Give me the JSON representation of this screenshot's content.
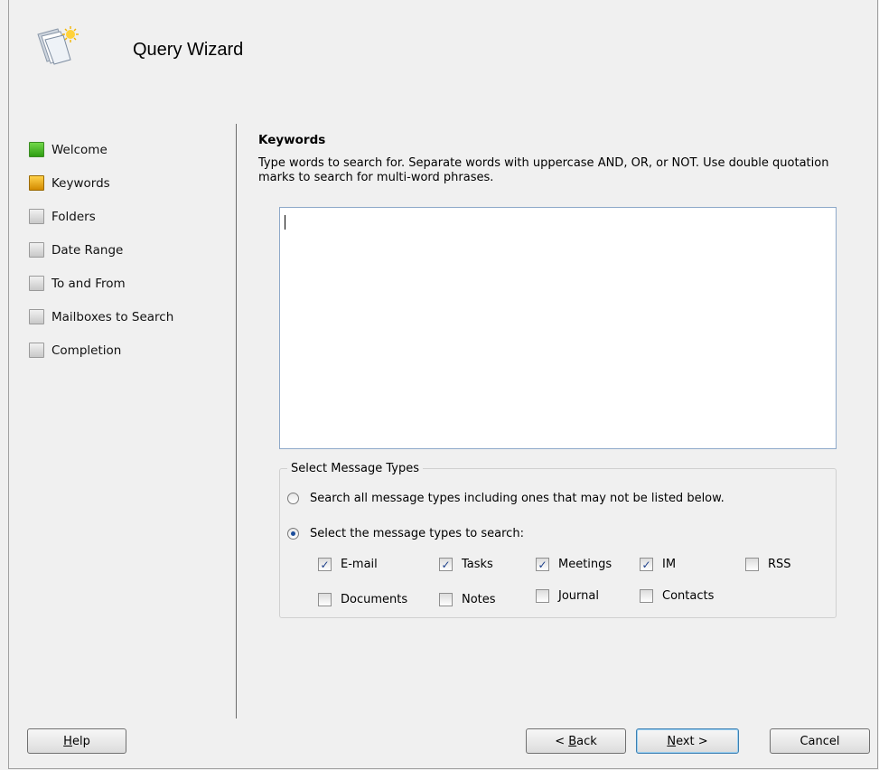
{
  "window": {
    "title": "Query Wizard"
  },
  "nav": {
    "items": [
      {
        "label": "Welcome",
        "state": "done"
      },
      {
        "label": "Keywords",
        "state": "current"
      },
      {
        "label": "Folders",
        "state": "pending"
      },
      {
        "label": "Date Range",
        "state": "pending"
      },
      {
        "label": "To and From",
        "state": "pending"
      },
      {
        "label": "Mailboxes to Search",
        "state": "pending"
      },
      {
        "label": "Completion",
        "state": "pending"
      }
    ]
  },
  "page": {
    "heading": "Keywords",
    "description": "Type words to search for. Separate words with uppercase AND, OR, or NOT. Use double quotation marks to search for multi-word phrases.",
    "keywords_value": ""
  },
  "message_types": {
    "legend": "Select Message Types",
    "radio_all": "Search all message types including ones that may not be listed below.",
    "radio_select": "Select the message types to search:",
    "selected_radio": "select",
    "checkboxes": [
      {
        "label": "E-mail",
        "checked": true
      },
      {
        "label": "Tasks",
        "checked": true
      },
      {
        "label": "Meetings",
        "checked": true
      },
      {
        "label": "IM",
        "checked": true
      },
      {
        "label": "RSS",
        "checked": false
      },
      {
        "label": "Documents",
        "checked": false
      },
      {
        "label": "Notes",
        "checked": false
      },
      {
        "label": "Journal",
        "checked": false
      },
      {
        "label": "Contacts",
        "checked": false
      }
    ]
  },
  "buttons": {
    "help": {
      "pre": "",
      "key": "H",
      "post": "elp"
    },
    "back": {
      "pre": "< ",
      "key": "B",
      "post": "ack"
    },
    "next": {
      "pre": "",
      "key": "N",
      "post": "ext >"
    },
    "cancel": "Cancel"
  },
  "colors": {
    "nav_done": "#2f9d12",
    "nav_current": "#d28a00",
    "nav_pending": "#c8c8c8",
    "check_mark": "#1d3f8a"
  }
}
